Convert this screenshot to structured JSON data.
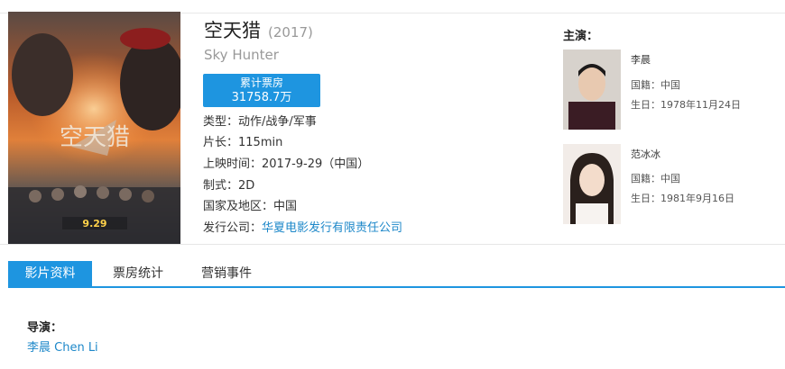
{
  "movie": {
    "title": "空天猎",
    "year": "(2017)",
    "english_title": "Sky Hunter",
    "box_office_label": "累计票房",
    "box_office_value": "31758.7万",
    "details": [
      {
        "label": "类型：",
        "value": "动作/战争/军事",
        "is_link": false
      },
      {
        "label": "片长：",
        "value": "115min",
        "is_link": false
      },
      {
        "label": "上映时间：",
        "value": "2017-9-29（中国）",
        "is_link": false
      },
      {
        "label": "制式：",
        "value": "2D",
        "is_link": false
      },
      {
        "label": "国家及地区：",
        "value": "中国",
        "is_link": false
      },
      {
        "label": "发行公司：",
        "value": "华夏电影发行有限责任公司",
        "is_link": true
      }
    ]
  },
  "cast": {
    "heading": "主演：",
    "actors": [
      {
        "name": "李晨",
        "nationality": "国籍：中国",
        "birthday": "生日：1978年11月24日"
      },
      {
        "name": "范冰冰",
        "nationality": "国籍：中国",
        "birthday": "生日：1981年9月16日"
      }
    ]
  },
  "tabs": [
    {
      "label": "影片资料",
      "active": true
    },
    {
      "label": "票房统计",
      "active": false
    },
    {
      "label": "营销事件",
      "active": false
    }
  ],
  "director": {
    "heading": "导演：",
    "name": "李晨 Chen Li"
  },
  "colors": {
    "accent": "#1e95e0",
    "link": "#1e88c9"
  }
}
